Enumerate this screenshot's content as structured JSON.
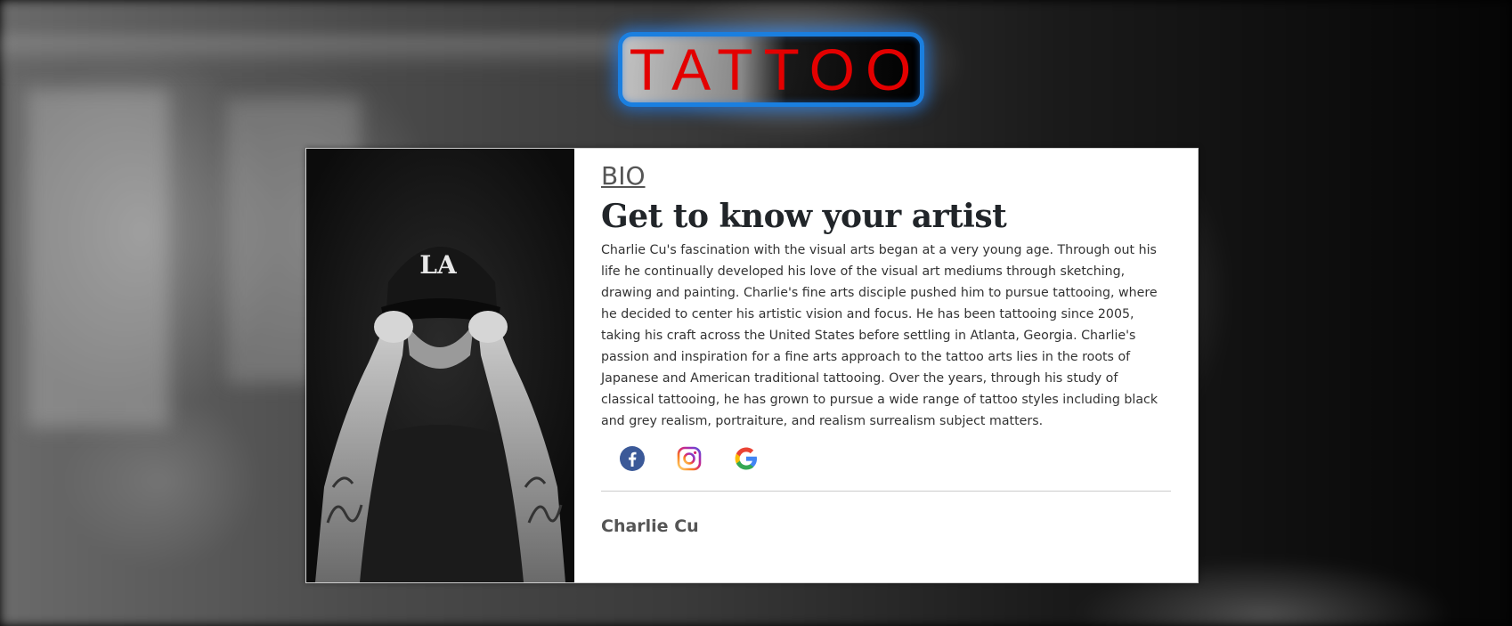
{
  "logo": {
    "text": "TATTOO"
  },
  "bio_card": {
    "section_label": "BIO",
    "headline": "Get to know your artist",
    "bio_paragraph": "Charlie Cu's fascination with the visual arts began at a very young age. Through out his life he continually developed his love of the visual art mediums through sketching, drawing and painting. Charlie's fine arts disciple pushed him to pursue tattooing, where he decided to center his artistic vision and focus. He has been tattooing since 2005, taking his craft across the United States before settling in Atlanta, Georgia. Charlie's passion and inspiration for a fine arts approach to the tattoo arts lies in the roots of Japanese and American traditional tattooing. Over the years, through his study of classical tattooing, he has grown to pursue a wide range of tattoo styles including black and grey realism, portraiture, and realism surrealism subject matters.",
    "artist_name": "Charlie Cu",
    "photo_cap_text": "LA",
    "social_icons": [
      "facebook-icon",
      "instagram-icon",
      "google-icon"
    ]
  },
  "colors": {
    "logo_text": "#e30000",
    "logo_border": "#1a7fe0",
    "facebook": "#3b5998",
    "google_blue": "#4285f4"
  }
}
